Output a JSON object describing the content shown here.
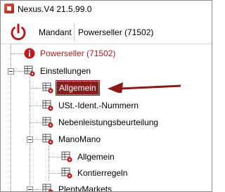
{
  "window": {
    "title": "Nexus.V4 21.5.99.0"
  },
  "toolbar": {
    "power_icon": "power-icon",
    "mandant_label": "Mandant",
    "mandant_value": "Powerseller (71502)"
  },
  "tree": {
    "root": {
      "label": "Powerseller (71502)",
      "icon": "info-icon"
    },
    "einstellungen": {
      "label": "Einstellungen",
      "icon": "settings-table-icon"
    },
    "allgemein": {
      "label": "Allgemein",
      "icon": "settings-table-icon",
      "selected": true
    },
    "ust": {
      "label": "USt.-Ident.-Nummern",
      "icon": "settings-table-icon"
    },
    "neben": {
      "label": "Nebenleistungsbeurteilung",
      "icon": "settings-table-icon"
    },
    "manomano": {
      "label": "ManoMano",
      "icon": "settings-table-icon"
    },
    "mm_allgemein": {
      "label": "Allgemein",
      "icon": "settings-table-icon"
    },
    "mm_kontierregeln": {
      "label": "Kontierregeln",
      "icon": "settings-table-icon"
    },
    "plentymarkets": {
      "label": "PlentyMarkets",
      "icon": "settings-table-icon"
    }
  },
  "colors": {
    "accent": "#8b1b1b",
    "root_text": "#b31b1b",
    "arrow": "#8b1b1b"
  }
}
